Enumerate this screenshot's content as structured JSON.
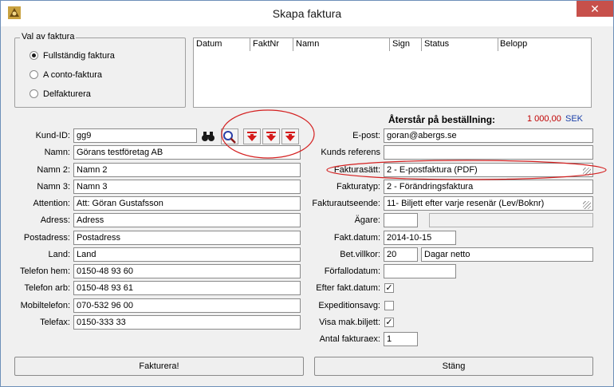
{
  "window": {
    "title": "Skapa faktura",
    "close_glyph": "✕"
  },
  "invoice_type": {
    "legend": "Val av faktura",
    "options": [
      {
        "label": "Fullständig faktura",
        "selected": true
      },
      {
        "label": "A conto-faktura",
        "selected": false
      },
      {
        "label": "Delfakturera",
        "selected": false
      }
    ]
  },
  "grid": {
    "columns": [
      "Datum",
      "FaktNr",
      "Namn",
      "Sign",
      "Status",
      "Belopp"
    ]
  },
  "remaining": {
    "label": "Återstår på beställning:",
    "amount": "1 000,00",
    "currency": "SEK",
    "color": "#c00000"
  },
  "customer": {
    "kund_id_label": "Kund-ID:",
    "kund_id": "gg9",
    "fields": [
      {
        "label": "Namn:",
        "value": "Görans testföretag AB"
      },
      {
        "label": "Namn 2:",
        "value": "Namn 2"
      },
      {
        "label": "Namn 3:",
        "value": "Namn 3"
      },
      {
        "label": "Attention:",
        "value": "Att: Göran Gustafsson"
      },
      {
        "label": "Adress:",
        "value": "Adress"
      },
      {
        "label": "Postadress:",
        "value": "Postadress"
      },
      {
        "label": "Land:",
        "value": "Land"
      },
      {
        "label": "Telefon hem:",
        "value": "0150-48 93 60"
      },
      {
        "label": "Telefon arb:",
        "value": "0150-48 93 61"
      },
      {
        "label": "Mobiltelefon:",
        "value": "070-532 96 00"
      },
      {
        "label": "Telefax:",
        "value": "0150-333 33"
      }
    ]
  },
  "right": {
    "email_label": "E-post:",
    "email": "goran@abergs.se",
    "ref_label": "Kunds referens",
    "ref": "",
    "method_label": "Fakturasätt:",
    "method": "2  - E-postfaktura (PDF)",
    "type_label": "Fakturatyp:",
    "type": "2  - Förändringsfaktura",
    "look_label": "Fakturautseende:",
    "look": "11- Biljett efter varje resenär (Lev/Boknr)",
    "owner_label": "Ägare:",
    "date_label": "Fakt.datum:",
    "date": "2014-10-15",
    "terms_label": "Bet.villkor:",
    "terms_days": "20",
    "terms_text": "Dagar netto",
    "due_label": "Förfallodatum:",
    "after_label": "Efter fakt.datum:",
    "after_checked": true,
    "fee_label": "Expeditionsavg:",
    "fee_checked": false,
    "maxticket_label": "Visa mak.biljett:",
    "maxticket_checked": true,
    "copies_label": "Antal fakturaex:",
    "copies": "1"
  },
  "buttons": {
    "invoice": "Fakturera!",
    "close": "Stäng"
  },
  "accent": {
    "annotation_red": "#d42020",
    "tool_red": "#d41a1a"
  }
}
